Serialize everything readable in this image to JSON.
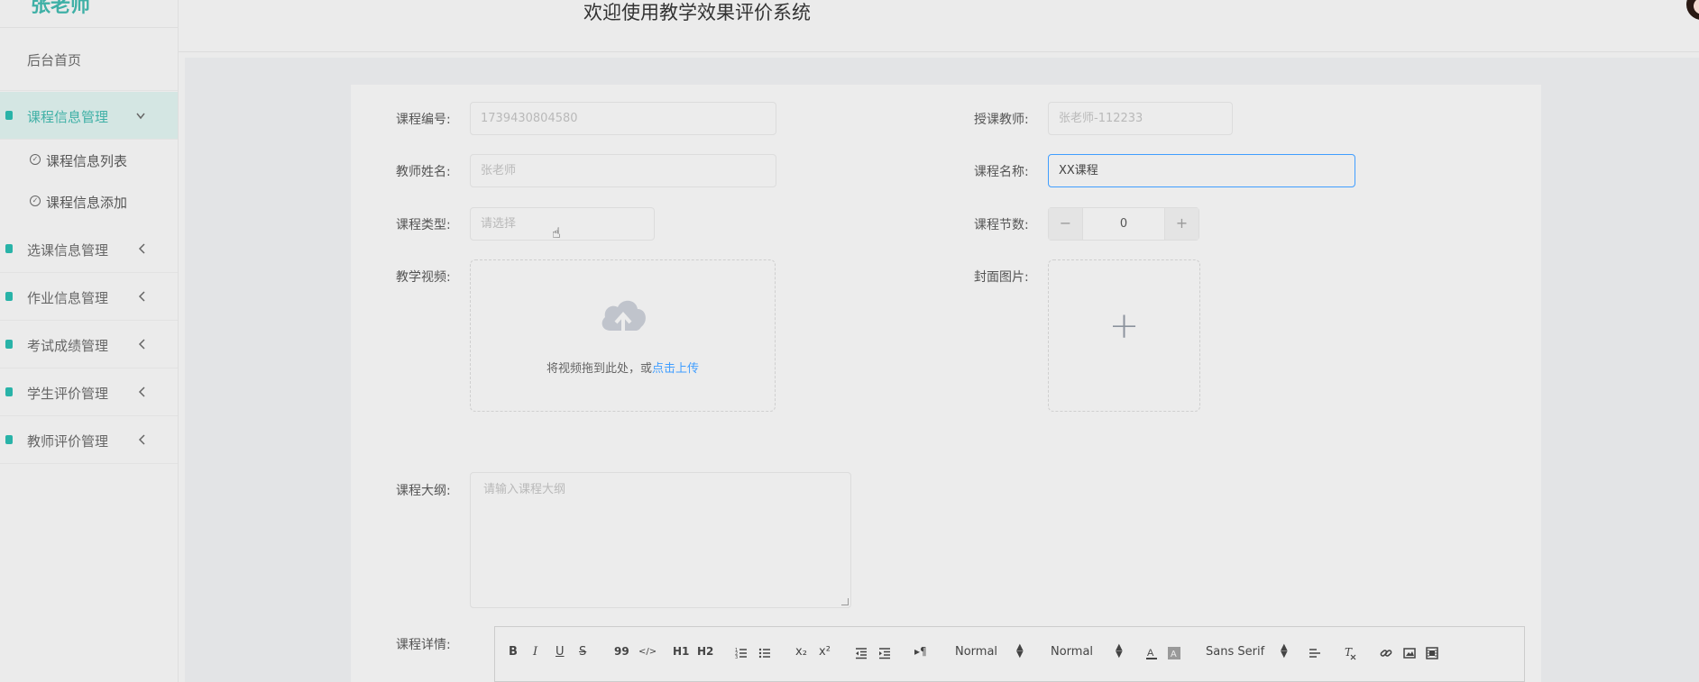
{
  "brand": {
    "name": "张老师"
  },
  "header": {
    "title": "欢迎使用教学效果评价系统"
  },
  "sidebar": {
    "home": "后台首页",
    "groups": [
      {
        "label": "课程信息管理",
        "expanded": true
      },
      {
        "label": "选课信息管理"
      },
      {
        "label": "作业信息管理"
      },
      {
        "label": "考试成绩管理"
      },
      {
        "label": "学生评价管理"
      },
      {
        "label": "教师评价管理"
      }
    ],
    "submenu": [
      "课程信息列表",
      "课程信息添加"
    ]
  },
  "form": {
    "course_no": {
      "label": "课程编号:",
      "value": "1739430804580"
    },
    "teacher_account": {
      "label": "授课教师:",
      "value": "张老师-112233"
    },
    "teacher_name": {
      "label": "教师姓名:",
      "value": "张老师"
    },
    "course_name": {
      "label": "课程名称:",
      "value": "XX课程"
    },
    "course_type": {
      "label": "课程类型:",
      "placeholder": "请选择"
    },
    "sessions": {
      "label": "课程节数:",
      "value": "0",
      "minus": "−",
      "plus": "+"
    },
    "video": {
      "label": "教学视频:",
      "hint": "将视频拖到此处，或",
      "link": "点击上传"
    },
    "cover": {
      "label": "封面图片:",
      "plus": "+"
    },
    "outline": {
      "label": "课程大纲:",
      "placeholder": "请输入课程大纲"
    },
    "detail": {
      "label": "课程详情:"
    }
  },
  "editor_toolbar": {
    "bold": "B",
    "italic": "I",
    "underline": "U",
    "strike": "S",
    "quote": "99",
    "code": "</>",
    "h1": "H1",
    "h2": "H2",
    "sub": "x₂",
    "sup": "x²",
    "header_picker": "Normal",
    "size_picker": "Normal",
    "font_picker": "Sans Serif",
    "rtl": "▸¶"
  },
  "colors": {
    "accent": "#3fb0a6",
    "link": "#409eff",
    "focus_border": "#409eff"
  }
}
